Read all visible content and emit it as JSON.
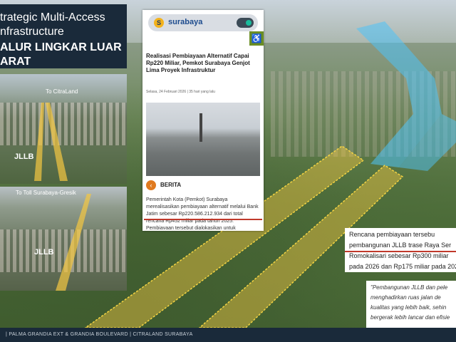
{
  "title_panel": {
    "line1": "trategic Multi-Access",
    "line2": "nfrastructure",
    "line3": "ALUR LINGKAR LUAR",
    "line4": "ARAT"
  },
  "photos": {
    "top_label": "To CitraLand",
    "top_jllb": "JLLB",
    "bottom_label": "To Toll Surabaya-Gresik",
    "bottom_jllb": "JLLB"
  },
  "phone": {
    "logo_text": "surabaya",
    "headline": "Realisasi Pembiayaan Alternatif Capai Rp220 Miliar, Pemkot Surabaya Genjot Lima Proyek Infrastruktur",
    "date": "Selasa, 24 Februari 2026 | 35 hari yang lalu",
    "section": "BERITA",
    "body": "Pemerintah Kota (Pemkot) Surabaya merealisasikan pembiayaan alternatif melalui Bank Jatim sebesar Rp220.586.212.934 dari total rencana Rp452 miliar pada tahun 2025. Pembiayaan tersebut dialokasikan untuk mendukung lima proyek"
  },
  "callout1": {
    "line1": "Rencana     pembiayaan     tersebu",
    "line2": "pembangunan JLLB trase Raya Ser",
    "line3": "Romokalisari sebesar Rp300 miliar",
    "line4": "pada 2026 dan Rp175 miliar pada 202"
  },
  "callout2": {
    "line1": "\"Pembangunan JLLB dan pele",
    "line2": "menghadirkan ruas jalan de",
    "line3": "kualitas yang lebih baik, sehin",
    "line4": "bergerak lebih lancar dan efisie"
  },
  "footer": {
    "text": "| PALMA GRANDIA EXT & GRANDIA BOULEVARD | CITRALAND SURABAYA"
  },
  "colors": {
    "navy": "#1a2a3a",
    "road_highlight": "#f5c842",
    "future_road": "#4fc3f7",
    "underline": "#c0392b"
  }
}
